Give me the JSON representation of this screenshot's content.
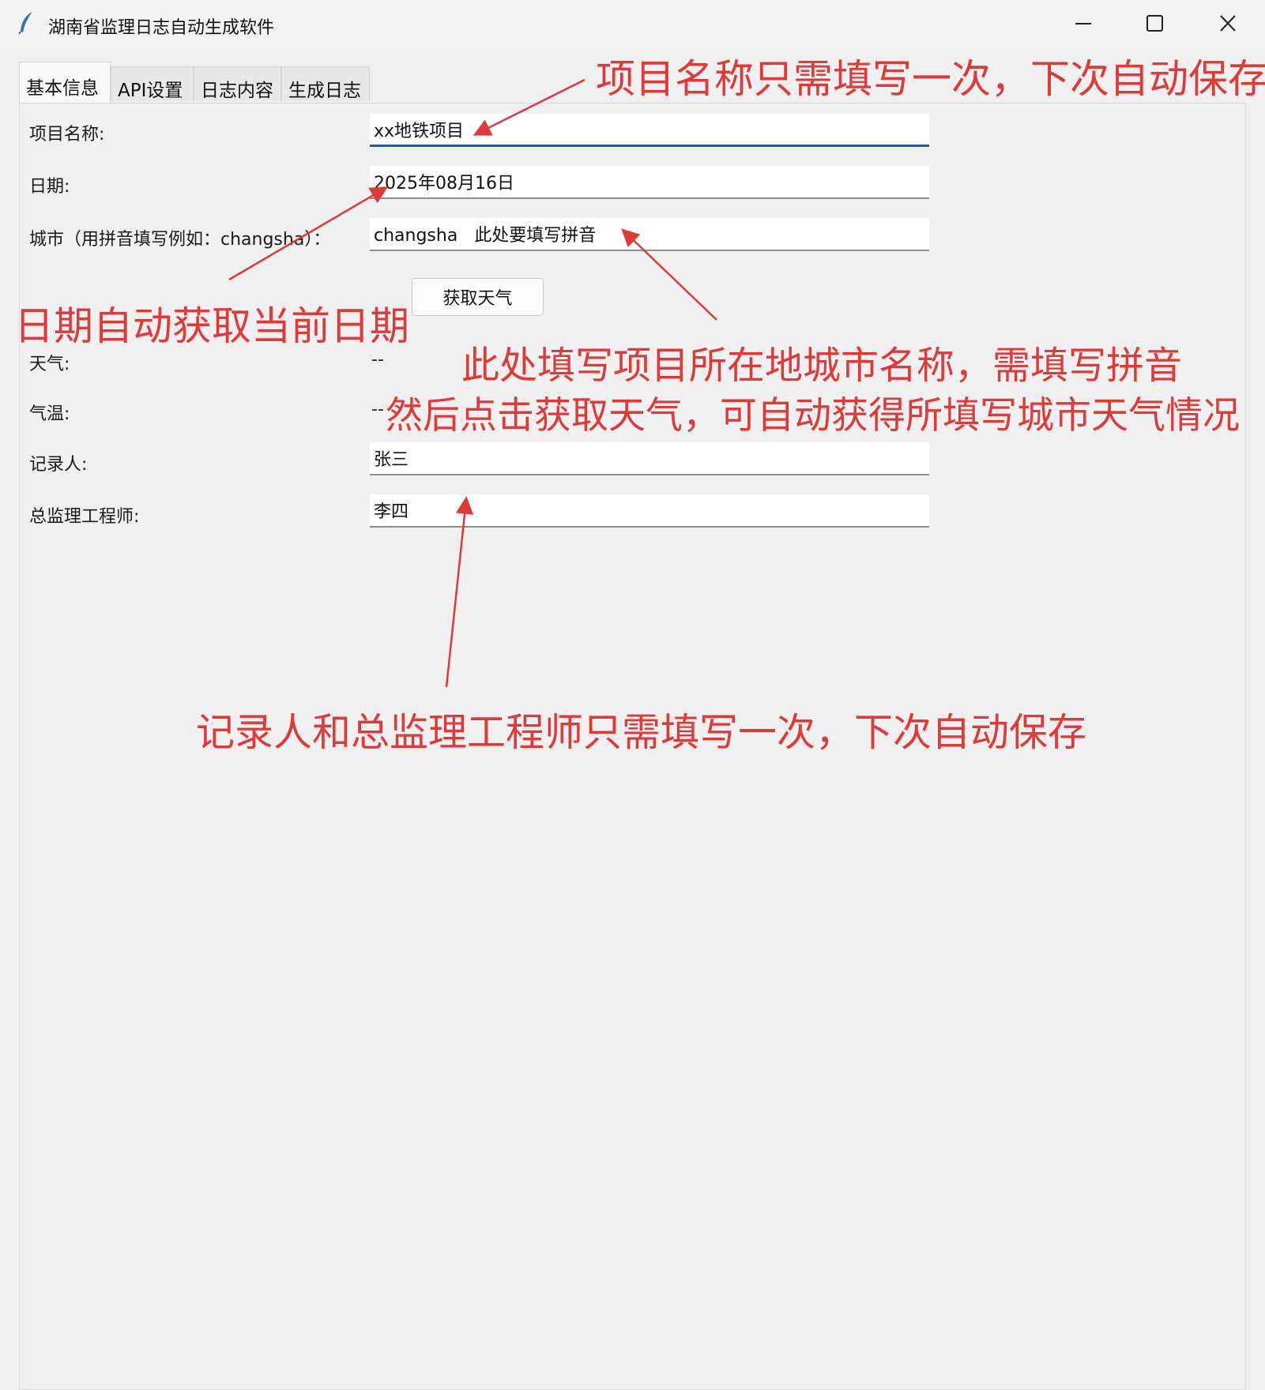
{
  "window": {
    "title": "湖南省监理日志自动生成软件",
    "icon": "feather-icon",
    "controls": [
      "minimize-icon",
      "maximize-icon",
      "close-icon"
    ]
  },
  "tabs": [
    {
      "label": "基本信息",
      "active": true
    },
    {
      "label": "API设置",
      "active": false
    },
    {
      "label": "日志内容",
      "active": false
    },
    {
      "label": "生成日志",
      "active": false
    }
  ],
  "form": {
    "project_name": {
      "label": "项目名称:",
      "value": "xx地铁项目"
    },
    "date": {
      "label": "日期:",
      "value": "2025年08月16日"
    },
    "city": {
      "label": "城市（用拼音填写例如：changsha）：",
      "value": "changsha   此处要填写拼音"
    },
    "weather_button": "获取天气",
    "weather": {
      "label": "天气:",
      "value": "--"
    },
    "temperature": {
      "label": "气温:",
      "value": "--"
    },
    "recorder": {
      "label": "记录人:",
      "value": "张三"
    },
    "chief_engineer": {
      "label": "总监理工程师:",
      "value": "李四"
    }
  },
  "annotations": {
    "project_note": "项目名称只需填写一次，下次自动保存",
    "date_note": "日期自动获取当前日期",
    "city_note_line1": "此处填写项目所在地城市名称，需填写拼音",
    "city_note_line2": "然后点击获取天气，可自动获得所填写城市天气情况",
    "people_note": "记录人和总监理工程师只需填写一次，下次自动保存",
    "color": "#de3a3a"
  }
}
